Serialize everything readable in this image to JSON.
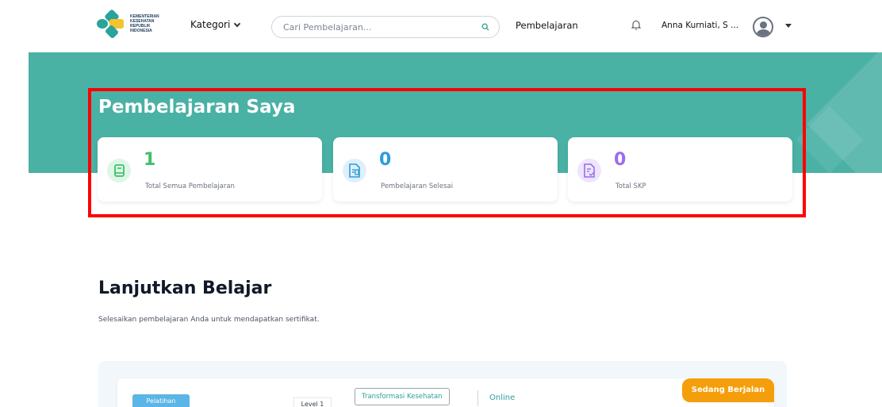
{
  "header": {
    "logo_text": "KEMENTERIAN KESEHATAN REPUBLIK INDONESIA",
    "kategori_label": "Kategori",
    "search_placeholder": "Cari Pembelajaran...",
    "nav_label": "Pembelajaran",
    "user_name": "Anna Kurniati, S ...",
    "icons": {
      "search": "search-icon",
      "bell": "bell-icon",
      "avatar": "user-avatar-icon",
      "caret": "caret-down-icon"
    }
  },
  "summary": {
    "title": "Pembelajaran Saya",
    "stats": [
      {
        "value": "1",
        "label": "Total Semua Pembelajaran",
        "color": "#3fc06a",
        "icon_bg": "#def6e6",
        "icon": "book-icon"
      },
      {
        "value": "0",
        "label": "Pembelajaran Selesai",
        "color": "#2d9cdb",
        "icon_bg": "#dff0fa",
        "icon": "document-list-icon"
      },
      {
        "value": "0",
        "label": "Total SKP",
        "color": "#9b6cf0",
        "icon_bg": "#eee6fd",
        "icon": "document-check-icon"
      }
    ]
  },
  "continue": {
    "title": "Lanjutkan Belajar",
    "subtitle": "Selesaikan pembelajaran Anda untuk mendapatkan sertifikat."
  },
  "course": {
    "type_badge": "Pelatihan",
    "level": "Level 1",
    "tag": "Transformasi Kesehatan",
    "mode": "Online",
    "status": "Sedang Berjalan"
  },
  "colors": {
    "banner": "#4ab1a5",
    "accent": "#2aa39a",
    "status": "#f59e0b",
    "highlight": "#ff0000"
  }
}
